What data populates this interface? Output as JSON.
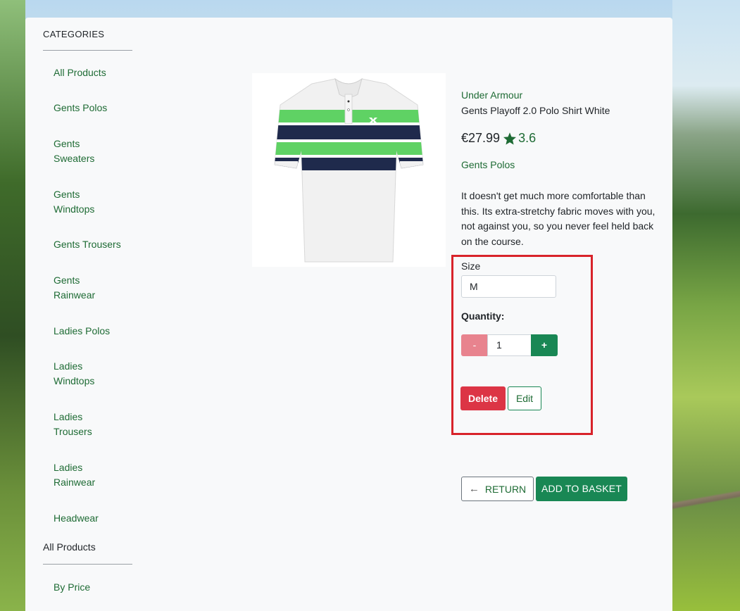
{
  "sidebar": {
    "categories_title": "CATEGORIES",
    "items": [
      {
        "label": "All Products"
      },
      {
        "label": "Gents Polos"
      },
      {
        "label": "Gents Sweaters"
      },
      {
        "label": "Gents Windtops"
      },
      {
        "label": "Gents Trousers"
      },
      {
        "label": "Gents Rainwear"
      },
      {
        "label": "Ladies Polos"
      },
      {
        "label": "Ladies Windtops"
      },
      {
        "label": "Ladies Trousers"
      },
      {
        "label": "Ladies Rainwear"
      },
      {
        "label": "Headwear"
      }
    ],
    "all_products_title": "All Products",
    "sort_items": [
      {
        "label": "By Price"
      }
    ]
  },
  "product": {
    "brand": "Under Armour",
    "name": "Gents Playoff 2.0 Polo Shirt White",
    "price": "€27.99",
    "rating": "3.6",
    "category": "Gents Polos",
    "description": "It doesn't get much more comfortable than this. Its extra-stretchy fabric moves with you, not against you, so you never feel held back on the course.",
    "image_icon": "polo-shirt-image",
    "colors": {
      "stripe_green": "#5fd264",
      "stripe_navy": "#1f2a4c",
      "shirt_white": "#f1f1f1"
    }
  },
  "form": {
    "size_label": "Size",
    "size_value": "M",
    "quantity_label": "Quantity:",
    "minus_label": "-",
    "quantity_value": "1",
    "plus_label": "+"
  },
  "admin": {
    "delete_label": "Delete",
    "edit_label": "Edit"
  },
  "actions": {
    "return_label": "RETURN",
    "add_to_basket_label": "ADD TO BASKET"
  },
  "theme": {
    "accent": "#198754",
    "danger": "#dc3545",
    "highlight": "#d8232a"
  }
}
